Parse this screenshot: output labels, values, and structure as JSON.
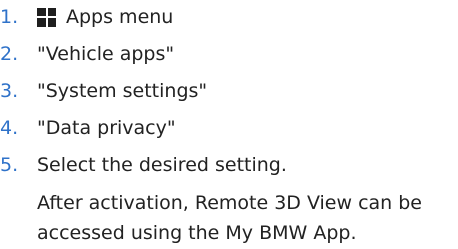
{
  "steps": [
    {
      "number": "1.",
      "icon": "apps-grid-icon",
      "text": "Apps menu"
    },
    {
      "number": "2.",
      "text": "\"Vehicle apps\""
    },
    {
      "number": "3.",
      "text": "\"System settings\""
    },
    {
      "number": "4.",
      "text": "\"Data privacy\""
    },
    {
      "number": "5.",
      "text": "Select the desired setting."
    }
  ],
  "note": "After activation, Remote 3D View can be accessed using the My BMW App.",
  "colors": {
    "number": "#2f72c9",
    "text": "#222222",
    "icon": "#1f1f1f",
    "background": "#ffffff"
  }
}
